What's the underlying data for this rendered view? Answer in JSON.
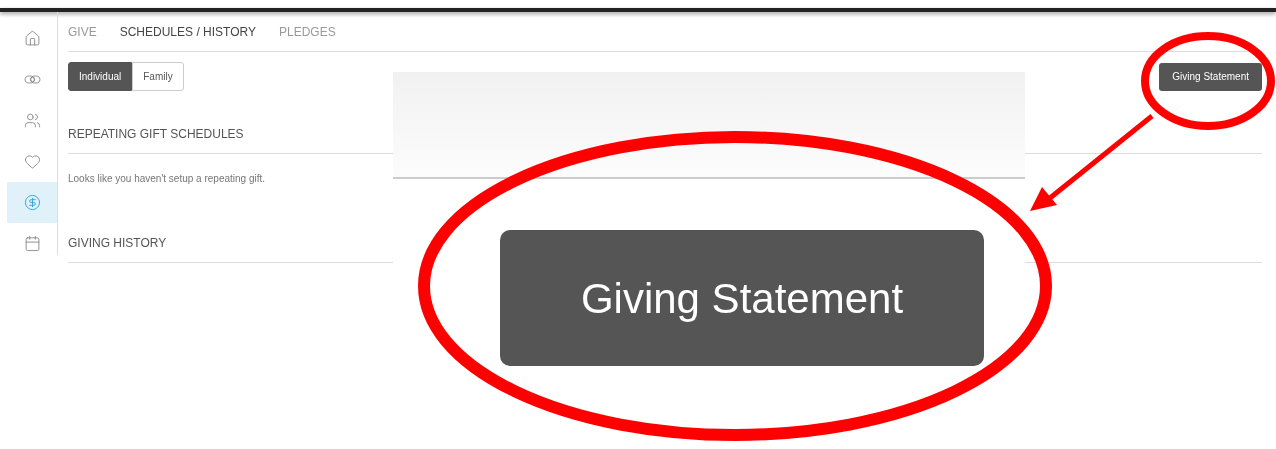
{
  "sidebar": {
    "items": [
      {
        "kind": "home",
        "selected": false
      },
      {
        "kind": "rings",
        "selected": false
      },
      {
        "kind": "people",
        "selected": false
      },
      {
        "kind": "heart",
        "selected": false
      },
      {
        "kind": "dollar",
        "selected": true
      },
      {
        "kind": "calendar",
        "selected": false
      }
    ]
  },
  "tabs": [
    {
      "label": "GIVE",
      "selected": false
    },
    {
      "label": "SCHEDULES / HISTORY",
      "selected": true
    },
    {
      "label": "PLEDGES",
      "selected": false
    }
  ],
  "segments": [
    {
      "label": "Individual",
      "selected": true
    },
    {
      "label": "Family",
      "selected": false
    }
  ],
  "statement_button": "Giving Statement",
  "sections": [
    {
      "title": "REPEATING GIFT SCHEDULES",
      "message": "Looks like you haven't setup a repeating gift."
    },
    {
      "title": "GIVING HISTORY"
    }
  ],
  "zoom_inset": {
    "button": "Giving Statement"
  }
}
